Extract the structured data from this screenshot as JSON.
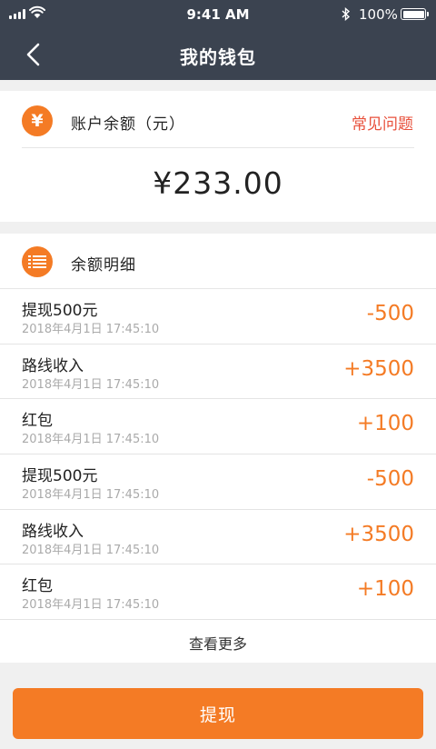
{
  "status_bar": {
    "time": "9:41 AM",
    "battery": "100%"
  },
  "nav": {
    "title": "我的钱包"
  },
  "balance_card": {
    "icon": "yen-icon",
    "label": "账户余额（元）",
    "faq_link": "常见问题",
    "amount": "¥233.00"
  },
  "detail_card": {
    "icon": "list-icon",
    "label": "余额明细",
    "rows": [
      {
        "title": "提现500元",
        "date": "2018年4月1日 17:45:10",
        "amount": "-500"
      },
      {
        "title": "路线收入",
        "date": "2018年4月1日 17:45:10",
        "amount": "+3500"
      },
      {
        "title": "红包",
        "date": "2018年4月1日 17:45:10",
        "amount": "+100"
      },
      {
        "title": "提现500元",
        "date": "2018年4月1日 17:45:10",
        "amount": "-500"
      },
      {
        "title": "路线收入",
        "date": "2018年4月1日 17:45:10",
        "amount": "+3500"
      },
      {
        "title": "红包",
        "date": "2018年4月1日 17:45:10",
        "amount": "+100"
      }
    ],
    "more_label": "查看更多"
  },
  "withdraw_button": {
    "label": "提现"
  },
  "colors": {
    "accent": "#f47b25",
    "header": "#3b4350",
    "link": "#e8513c"
  }
}
